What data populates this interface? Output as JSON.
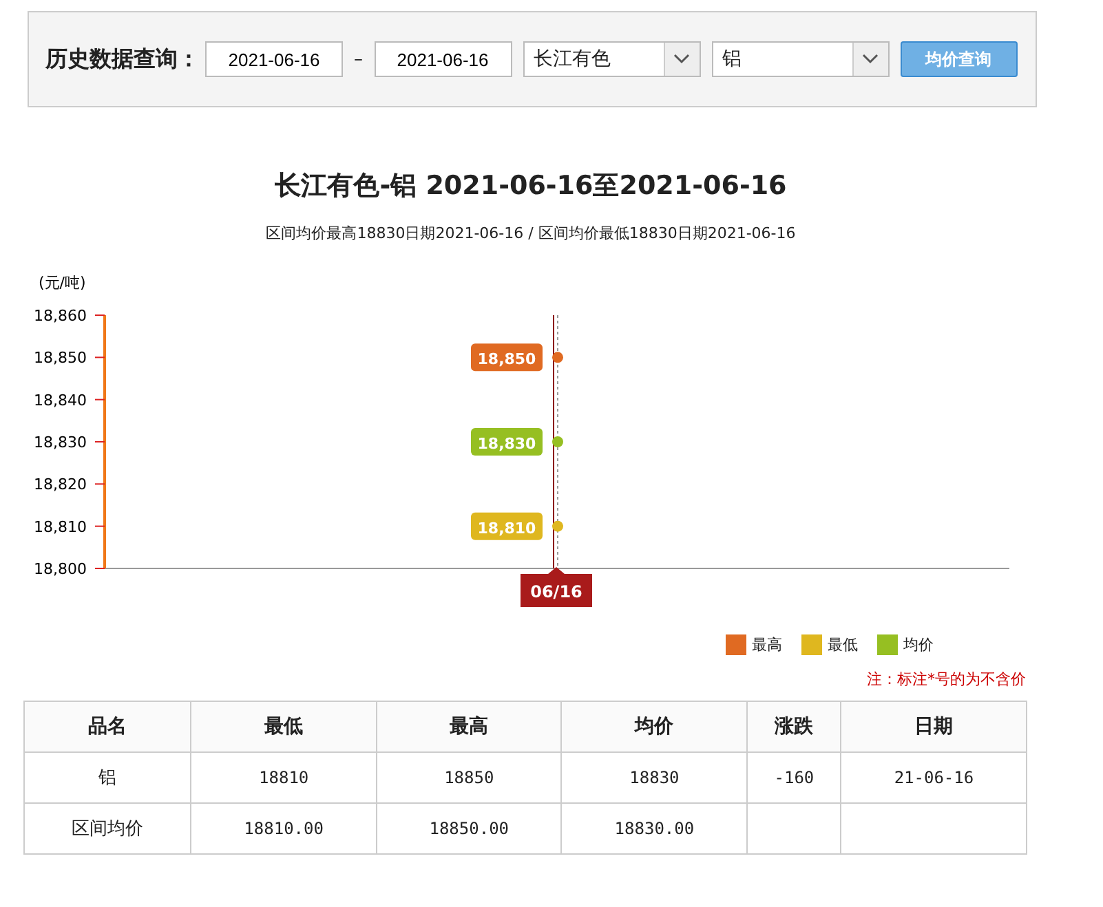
{
  "query": {
    "label": "历史数据查询：",
    "start_date": "2021-06-16",
    "separator": "–",
    "end_date": "2021-06-16",
    "market": "长江有色",
    "metal": "铝",
    "button": "均价查询"
  },
  "chart": {
    "title": "长江有色-铝 2021-06-16至2021-06-16",
    "subtitle": "区间均价最高18830日期2021-06-16 / 区间均价最低18830日期2021-06-16",
    "chart_data": {
      "type": "line",
      "ylabel": "(元/吨)",
      "categories": [
        "06/16"
      ],
      "ylim": [
        18800,
        18860
      ],
      "yticks": [
        {
          "value": 18800,
          "label": "18,800"
        },
        {
          "value": 18810,
          "label": "18,810"
        },
        {
          "value": 18820,
          "label": "18,820"
        },
        {
          "value": 18830,
          "label": "18,830"
        },
        {
          "value": 18840,
          "label": "18,840"
        },
        {
          "value": 18850,
          "label": "18,850"
        },
        {
          "value": 18860,
          "label": "18,860"
        }
      ],
      "series": [
        {
          "name": "最高",
          "color": "#e06a22",
          "marker": "circle",
          "values": [
            18850
          ]
        },
        {
          "name": "最低",
          "color": "#dfb71f",
          "marker": "circle",
          "values": [
            18810
          ]
        },
        {
          "name": "均价",
          "color": "#96bf22",
          "marker": "circle",
          "values": [
            18830
          ]
        }
      ],
      "ref_lines": [
        {
          "axis": "x",
          "value": "06/16",
          "color": "#8b0000"
        },
        {
          "axis": "x",
          "value": "06/16",
          "color": "#999999"
        }
      ],
      "value_labels": [
        "18,850",
        "18,810",
        "18,830"
      ]
    }
  },
  "note": "注：标注*号的为不含价",
  "table": {
    "columns": [
      "品名",
      "最低",
      "最高",
      "均价",
      "涨跌",
      "日期"
    ],
    "rows": [
      [
        "铝",
        "18810",
        "18850",
        "18830",
        "-160",
        "21-06-16"
      ],
      [
        "区间均价",
        "18810.00",
        "18850.00",
        "18830.00",
        "",
        ""
      ]
    ]
  }
}
